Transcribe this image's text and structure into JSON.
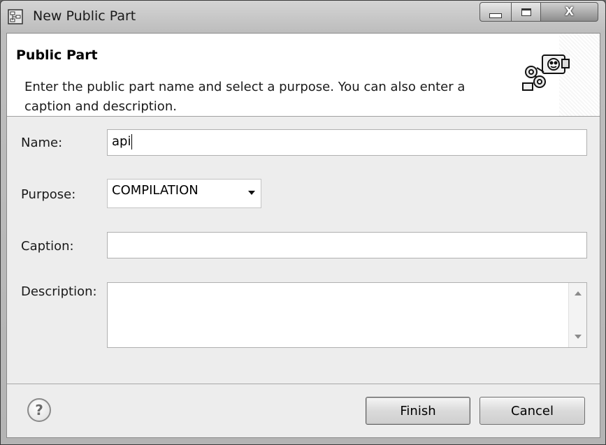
{
  "window": {
    "title": "New Public Part",
    "close_glyph": "X"
  },
  "banner": {
    "title": "Public Part",
    "description": "Enter the public part name and select a purpose. You can also enter a caption and description.",
    "icon": "public-part-wizard-icon"
  },
  "form": {
    "name_label": "Name:",
    "name_value": "api",
    "purpose_label": "Purpose:",
    "purpose_value": "COMPILATION",
    "caption_label": "Caption:",
    "caption_value": "",
    "description_label": "Description:",
    "description_value": ""
  },
  "footer": {
    "help_glyph": "?",
    "finish_label": "Finish",
    "cancel_label": "Cancel"
  }
}
